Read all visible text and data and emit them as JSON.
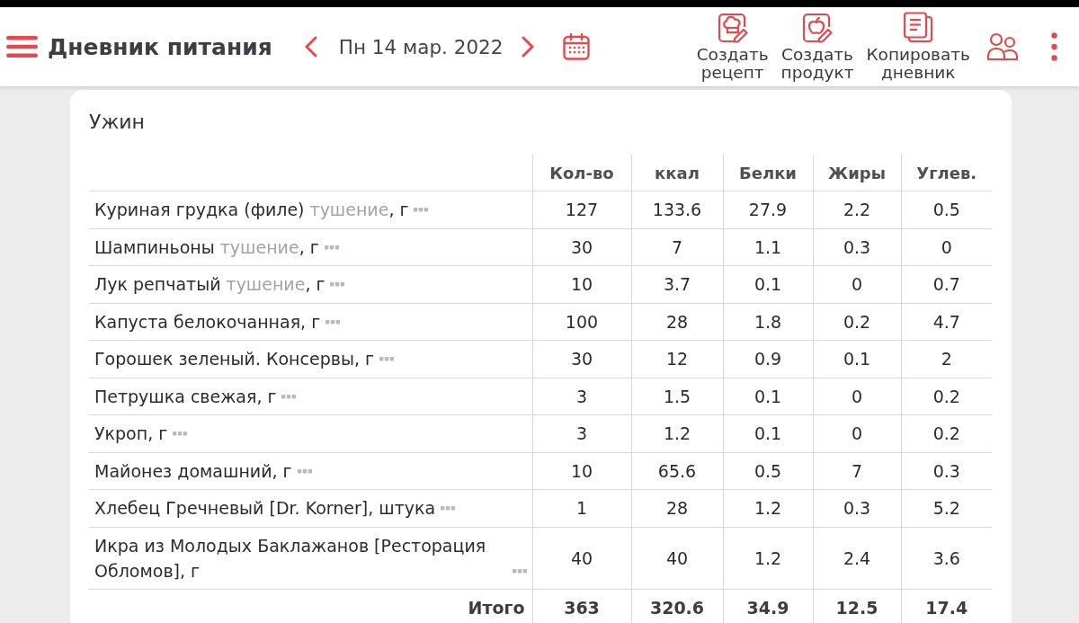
{
  "header": {
    "title": "Дневник питания",
    "date": "Пн 14 мар. 2022",
    "actions": [
      {
        "kind": "recipe",
        "label": "Создать рецепт"
      },
      {
        "kind": "product",
        "label": "Создать продукт"
      },
      {
        "kind": "copy",
        "label": "Копировать дневник"
      }
    ]
  },
  "meal": {
    "title": "Ужин",
    "columns": [
      "Кол-во",
      "ккал",
      "Белки",
      "Жиры",
      "Углев."
    ],
    "rows": [
      {
        "name": [
          {
            "text": "Куриная грудка (филе)",
            "muted": false
          },
          {
            "text": "тушение",
            "muted": true
          },
          {
            "text": ", г",
            "muted": false
          }
        ],
        "values": [
          "127",
          "133.6",
          "27.9",
          "2.2",
          "0.5"
        ]
      },
      {
        "name": [
          {
            "text": "Шампиньоны",
            "muted": false
          },
          {
            "text": "тушение",
            "muted": true
          },
          {
            "text": ", г",
            "muted": false
          }
        ],
        "values": [
          "30",
          "7",
          "1.1",
          "0.3",
          "0"
        ]
      },
      {
        "name": [
          {
            "text": "Лук репчатый",
            "muted": false
          },
          {
            "text": "тушение",
            "muted": true
          },
          {
            "text": ", г",
            "muted": false
          }
        ],
        "values": [
          "10",
          "3.7",
          "0.1",
          "0",
          "0.7"
        ]
      },
      {
        "name": [
          {
            "text": "Капуста белокочанная, г",
            "muted": false
          }
        ],
        "values": [
          "100",
          "28",
          "1.8",
          "0.2",
          "4.7"
        ]
      },
      {
        "name": [
          {
            "text": "Горошек зеленый. Консервы, г",
            "muted": false
          }
        ],
        "values": [
          "30",
          "12",
          "0.9",
          "0.1",
          "2"
        ]
      },
      {
        "name": [
          {
            "text": "Петрушка свежая, г",
            "muted": false
          }
        ],
        "values": [
          "3",
          "1.5",
          "0.1",
          "0",
          "0.2"
        ]
      },
      {
        "name": [
          {
            "text": "Укроп, г",
            "muted": false
          }
        ],
        "values": [
          "3",
          "1.2",
          "0.1",
          "0",
          "0.2"
        ]
      },
      {
        "name": [
          {
            "text": "Майонез домашний, г",
            "muted": false
          }
        ],
        "values": [
          "10",
          "65.6",
          "0.5",
          "7",
          "0.3"
        ]
      },
      {
        "name": [
          {
            "text": "Хлебец Гречневый [Dr. Korner], штука",
            "muted": false
          }
        ],
        "values": [
          "1",
          "28",
          "1.2",
          "0.3",
          "5.2"
        ]
      },
      {
        "name": [
          {
            "text": "Икра из Молодых Баклажанов [Ресторация Обломов], г",
            "muted": false
          }
        ],
        "values": [
          "40",
          "40",
          "1.2",
          "2.4",
          "3.6"
        ]
      }
    ],
    "total": {
      "label": "Итого",
      "values": [
        "363",
        "320.6",
        "34.9",
        "12.5",
        "17.4"
      ]
    }
  }
}
